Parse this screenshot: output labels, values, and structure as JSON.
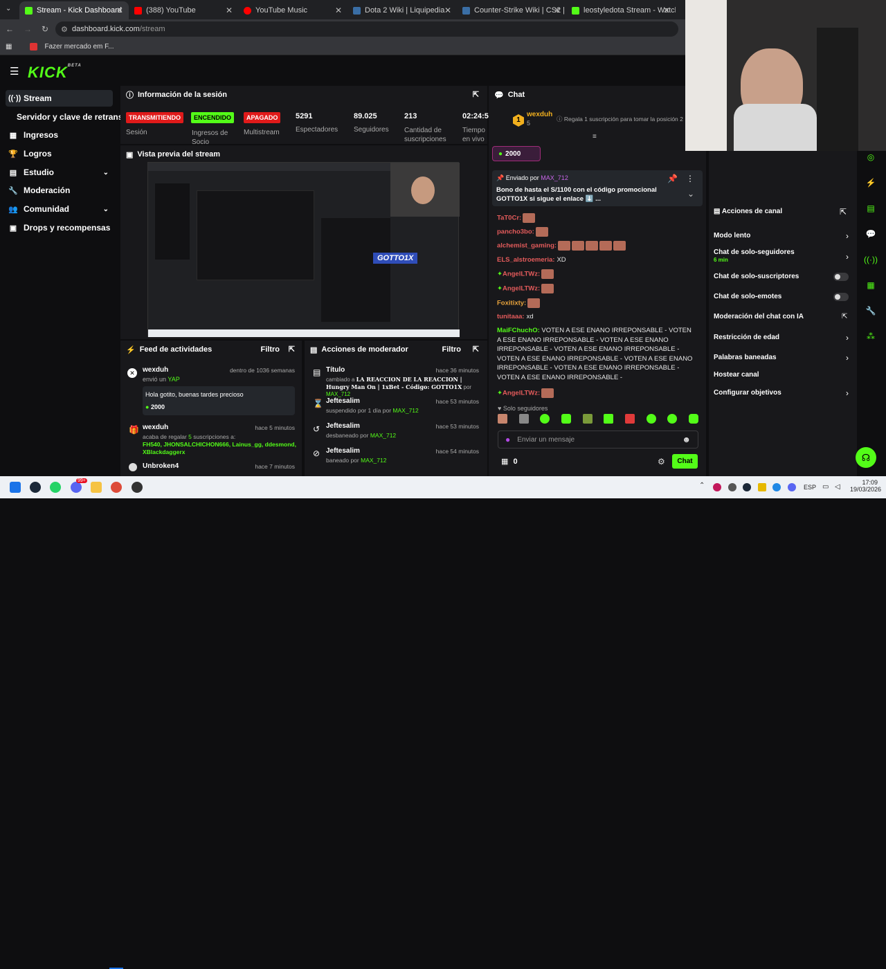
{
  "browser": {
    "tabs": [
      {
        "title": "Stream - Kick Dashboard",
        "color": "#53fc18"
      },
      {
        "title": "(388) YouTube",
        "color": "#ff0000"
      },
      {
        "title": "YouTube Music",
        "color": "#ff0000"
      },
      {
        "title": "Dota 2 Wiki | Liquipedia",
        "color": "#3a6ea5"
      },
      {
        "title": "Counter-Strike Wiki | CS2 | Liqu",
        "color": "#3a6ea5"
      },
      {
        "title": "leostyledota Stream - Watch Li",
        "color": "#53fc18"
      }
    ],
    "url_host": "dashboard.kick.com",
    "url_path": "/stream",
    "bookmark": "Fazer mercado em F..."
  },
  "sidebar": {
    "logo": "KICK",
    "beta": "BETA",
    "items": [
      "Stream",
      "Servidor y clave de retransm",
      "Ingresos",
      "Logros",
      "Estudio",
      "Moderación",
      "Comunidad",
      "Drops y recompensas"
    ]
  },
  "session": {
    "title": "Información de la sesión",
    "badges": [
      {
        "text": "TRANSMITIENDO",
        "bg": "#e01a1a",
        "fg": "#fff"
      },
      {
        "text": "ENCENDIDO",
        "bg": "#53fc18",
        "fg": "#000"
      },
      {
        "text": "APAGADO",
        "bg": "#e01a1a",
        "fg": "#fff"
      }
    ],
    "labels": [
      "Sesión",
      "Ingresos de Socio",
      "Multistream",
      "Espectadores",
      "Seguidores",
      "Cantidad de suscripciones",
      "Tiempo en vivo"
    ],
    "viewers": "5291",
    "followers": "89.025",
    "subs": "213",
    "time": "02:24:5"
  },
  "preview": {
    "title": "Vista previa del stream",
    "overlay": "GOTTO1X"
  },
  "feed": {
    "title": "Feed de actividades",
    "filter": "Filtro",
    "items": [
      {
        "user": "wexduh",
        "time": "dentro de 1036 semanas",
        "action": "envió un",
        "target": "YAP",
        "message": "Hola gotito, buenas tardes precioso",
        "amount": "2000"
      },
      {
        "user": "wexduh",
        "time": "hace 5 minutos",
        "action": "acaba de regalar",
        "count": "5",
        "action2": "suscripciones a:",
        "names": "FH540, JHONSALCHICHON666, Lainus_gg, ddesmond, XBlackdaggerx"
      },
      {
        "user": "Unbroken4",
        "time": "hace 7 minutos"
      }
    ]
  },
  "modactions": {
    "title": "Acciones de moderador",
    "filter": "Filtro",
    "items": [
      {
        "title": "Título",
        "time": "hace 36 minutos",
        "line1": "cambiado a",
        "bold": "LA REACCION DE LA REACCION | Hungry Man On | 1xBet - Código: GOTTO1X",
        "por": "por",
        "who": "MAX_712"
      },
      {
        "title": "Jeftesalim",
        "time": "hace 53 minutos",
        "line1": "suspendido por 1 día por",
        "who": "MAX_712"
      },
      {
        "title": "Jeftesalim",
        "time": "hace 53 minutos",
        "line1": "desbaneado por",
        "who": "MAX_712"
      },
      {
        "title": "Jeftesalim",
        "time": "hace 54 minutos",
        "line1": "baneado por",
        "who": "MAX_712"
      }
    ]
  },
  "chat": {
    "title": "Chat",
    "top_user": "wexduh",
    "top_count": "5",
    "top_rank": "1",
    "gift_hint": "Regala 1 suscripción para tomar la posición 2",
    "kicks": "2000",
    "pinned_by_label": "Enviado por",
    "pinned_by": "MAX_712",
    "pinned_text": "Bono de hasta el S/1100 con el código promocional GOTTO1X si sigue el enlace ⬇️ ...",
    "messages": [
      {
        "user": "TaT0Cr:",
        "color": "#e45b5b",
        "text": "",
        "emotes": 1
      },
      {
        "user": "pancho3bo:",
        "color": "#e45b5b",
        "text": "",
        "emotes": 1
      },
      {
        "user": "alchemist_gaming:",
        "color": "#e45b5b",
        "text": "",
        "emotes": 5
      },
      {
        "user": "ELS_alstroemeria:",
        "color": "#e45b5b",
        "text": "XD",
        "emotes": 0
      },
      {
        "user": "AngelLTWz:",
        "color": "#e45b5b",
        "text": "",
        "emotes": 1
      },
      {
        "user": "AngelLTWz:",
        "color": "#e45b5b",
        "text": "",
        "emotes": 1
      },
      {
        "user": "Foxitixty:",
        "color": "#e8a33c",
        "text": "",
        "emotes": 1
      },
      {
        "user": "tunitaaa:",
        "color": "#e45b5b",
        "text": "xd",
        "emotes": 0
      }
    ],
    "long_user": "MaiFChuchO:",
    "long_text": "VOTEN A ESE ENANO IRREPONSABLE - VOTEN A ESE ENANO IRREPONSABLE - VOTEN A ESE ENANO IRREPONSABLE - VOTEN A ESE ENANO IRREPONSABLE - VOTEN A ESE ENANO IRREPONSABLE - VOTEN A ESE ENANO IRREPONSABLE - VOTEN A ESE ENANO IRREPONSABLE - VOTEN A ESE ENANO IRREPONSABLE -",
    "last_user": "AngelLTWz:",
    "mode": "Solo seguidores",
    "placeholder": "Enviar un mensaje",
    "balance": "0",
    "send": "Chat"
  },
  "channel_actions": {
    "title": "Acciones de canal",
    "items": [
      "Modo lento",
      "Chat de solo-seguidores",
      "Chat de solo-suscriptores",
      "Chat de solo-emotes",
      "Moderación del chat con IA",
      "Restricción de edad",
      "Palabras baneadas",
      "Hostear canal",
      "Configurar objetivos"
    ],
    "slow_sub": "6 min"
  },
  "taskbar": {
    "lang": "ESP",
    "time": "17:09",
    "date": "19/03/2026",
    "notif": "99+"
  }
}
